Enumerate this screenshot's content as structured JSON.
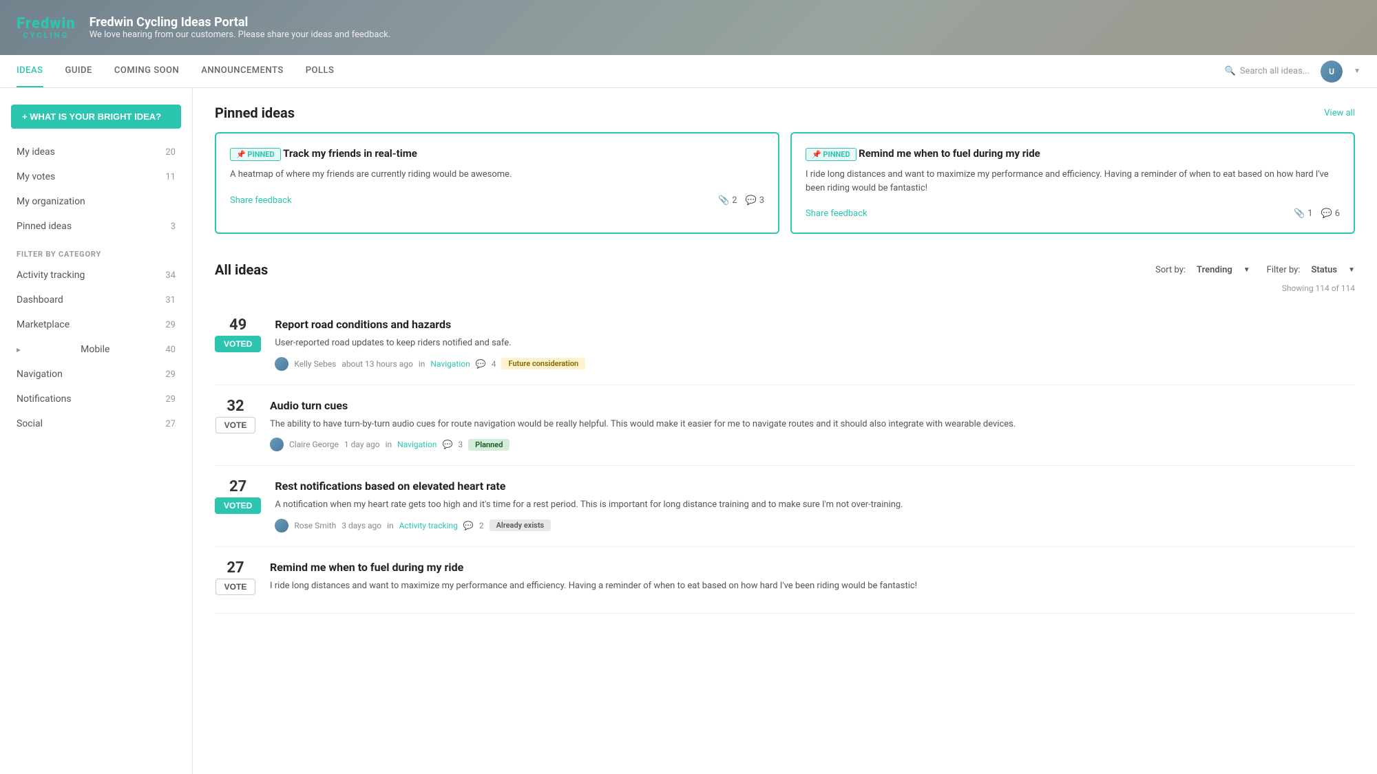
{
  "header": {
    "logo_top": "Fredwin",
    "logo_bottom": "CYCLING",
    "title": "Fredwin Cycling Ideas Portal",
    "subtitle": "We love hearing from our customers. Please share your ideas and feedback."
  },
  "nav": {
    "tabs": [
      {
        "label": "IDEAS",
        "active": true
      },
      {
        "label": "GUIDE",
        "active": false
      },
      {
        "label": "COMING SOON",
        "active": false
      },
      {
        "label": "ANNOUNCEMENTS",
        "active": false
      },
      {
        "label": "POLLS",
        "active": false
      }
    ],
    "search_placeholder": "Search all ideas..."
  },
  "sidebar": {
    "new_idea_btn": "+ WHAT IS YOUR BRIGHT IDEA?",
    "items": [
      {
        "label": "My ideas",
        "count": "20"
      },
      {
        "label": "My votes",
        "count": "11"
      },
      {
        "label": "My organization",
        "count": ""
      },
      {
        "label": "Pinned ideas",
        "count": "3"
      }
    ],
    "filter_title": "FILTER BY CATEGORY",
    "categories": [
      {
        "label": "Activity tracking",
        "count": "34"
      },
      {
        "label": "Dashboard",
        "count": "31"
      },
      {
        "label": "Marketplace",
        "count": "29"
      },
      {
        "label": "Mobile",
        "count": "40",
        "has_arrow": true
      },
      {
        "label": "Navigation",
        "count": "29"
      },
      {
        "label": "Notifications",
        "count": "29"
      },
      {
        "label": "Social",
        "count": "27"
      }
    ]
  },
  "pinned": {
    "title": "Pinned ideas",
    "view_all": "View all",
    "cards": [
      {
        "badge": "📌 PINNED",
        "title": "Track my friends in real-time",
        "desc": "A heatmap of where my friends are currently riding would be awesome.",
        "share_feedback": "Share feedback",
        "attachments": "2",
        "comments": "3"
      },
      {
        "badge": "📌 PINNED",
        "title": "Remind me when to fuel during my ride",
        "desc": "I ride long distances and want to maximize my performance and efficiency. Having a reminder of when to eat based on how hard I've been riding would be fantastic!",
        "share_feedback": "Share feedback",
        "attachments": "1",
        "comments": "6"
      }
    ]
  },
  "all_ideas": {
    "title": "All ideas",
    "sort_label": "Sort by:",
    "sort_value": "Trending",
    "filter_label": "Filter by:",
    "filter_value": "Status",
    "showing": "Showing 114 of 114",
    "items": [
      {
        "votes": "49",
        "voted": true,
        "title": "Report road conditions and hazards",
        "desc": "User-reported road updates to keep riders notified and safe.",
        "author": "Kelly Sebes",
        "time": "about 13 hours ago",
        "category": "Navigation",
        "comments": "4",
        "status": "Future consideration",
        "status_type": "future"
      },
      {
        "votes": "32",
        "voted": false,
        "title": "Audio turn cues",
        "desc": "The ability to have turn-by-turn audio cues for route navigation would be really helpful. This would make it easier for me to navigate routes and it should also integrate with wearable devices.",
        "author": "Claire George",
        "time": "1 day ago",
        "category": "Navigation",
        "comments": "3",
        "status": "Planned",
        "status_type": "planned"
      },
      {
        "votes": "27",
        "voted": true,
        "title": "Rest notifications based on elevated heart rate",
        "desc": "A notification when my heart rate gets too high and it's time for a rest period. This is important for long distance training and to make sure I'm not over-training.",
        "author": "Rose Smith",
        "time": "3 days ago",
        "category": "Activity tracking",
        "comments": "2",
        "status": "Already exists",
        "status_type": "exists"
      },
      {
        "votes": "27",
        "voted": false,
        "title": "Remind me when to fuel during my ride",
        "desc": "I ride long distances and want to maximize my performance and efficiency. Having a reminder of when to eat based on how hard I've been riding would be fantastic!",
        "author": "",
        "time": "",
        "category": "",
        "comments": "",
        "status": "",
        "status_type": ""
      }
    ]
  }
}
